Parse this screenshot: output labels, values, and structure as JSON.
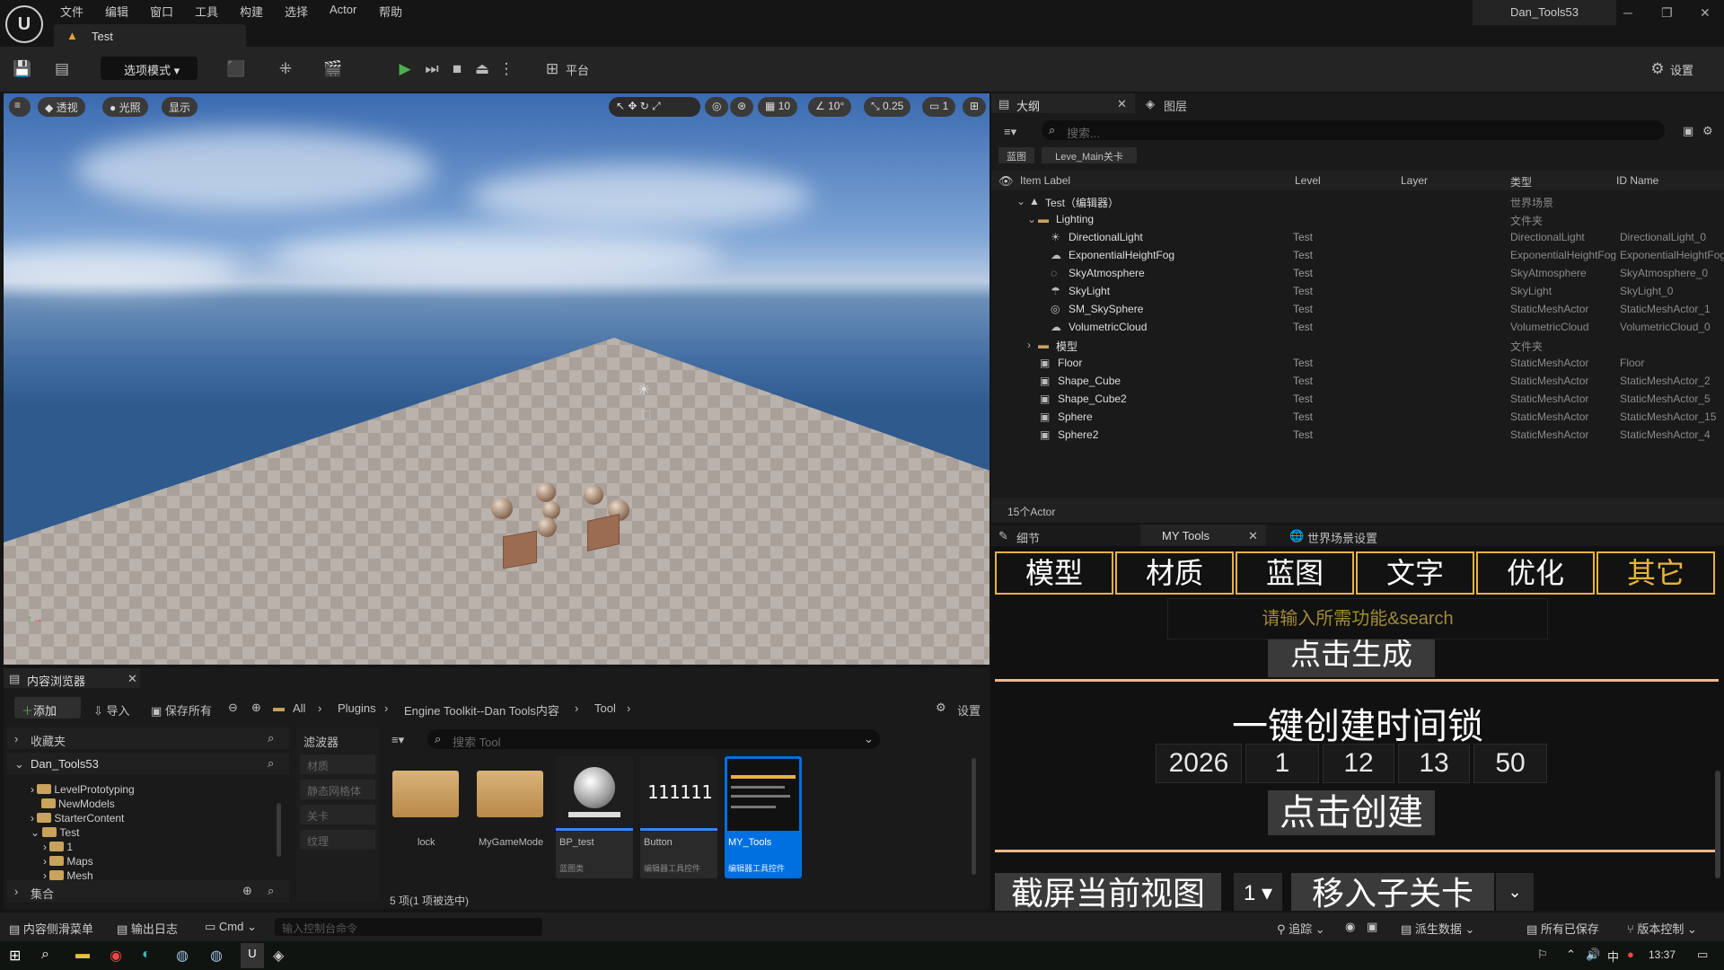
{
  "app": {
    "project_name": "Dan_Tools53",
    "doc_tab": "Test",
    "logo_text": "U"
  },
  "menu": [
    "文件",
    "编辑",
    "窗口",
    "工具",
    "构建",
    "选择",
    "Actor",
    "帮助"
  ],
  "toolbar": {
    "mode_label": "选项模式",
    "platform_label": "平台",
    "settings_label": "设置"
  },
  "viewport": {
    "perspective": "透视",
    "lighting": "光照",
    "show": "显示",
    "grid_size": "10",
    "rotation_snap": "10°",
    "scale_snap": "0.25",
    "camera_speed": "1"
  },
  "outliner": {
    "tab_title": "大纲",
    "layers_tab": "图层",
    "search_placeholder": "搜索...",
    "filter_chips": [
      "蓝图",
      "Leve_Main关卡"
    ],
    "columns": [
      "Item Label",
      "Level",
      "Layer",
      "类型",
      "ID Name"
    ],
    "rows": [
      {
        "label": "Test（编辑器）",
        "level": "",
        "type": "世界场景",
        "id": ""
      },
      {
        "label": "Lighting",
        "level": "",
        "type": "文件夹",
        "id": ""
      },
      {
        "label": "DirectionalLight",
        "level": "Test",
        "type": "DirectionalLight",
        "id": "DirectionalLight_0"
      },
      {
        "label": "ExponentialHeightFog",
        "level": "Test",
        "type": "ExponentialHeightFog",
        "id": "ExponentialHeightFog"
      },
      {
        "label": "SkyAtmosphere",
        "level": "Test",
        "type": "SkyAtmosphere",
        "id": "SkyAtmosphere_0"
      },
      {
        "label": "SkyLight",
        "level": "Test",
        "type": "SkyLight",
        "id": "SkyLight_0"
      },
      {
        "label": "SM_SkySphere",
        "level": "Test",
        "type": "StaticMeshActor",
        "id": "StaticMeshActor_1"
      },
      {
        "label": "VolumetricCloud",
        "level": "Test",
        "type": "VolumetricCloud",
        "id": "VolumetricCloud_0"
      },
      {
        "label": "模型",
        "level": "",
        "type": "文件夹",
        "id": ""
      },
      {
        "label": "Floor",
        "level": "Test",
        "type": "StaticMeshActor",
        "id": "Floor"
      },
      {
        "label": "Shape_Cube",
        "level": "Test",
        "type": "StaticMeshActor",
        "id": "StaticMeshActor_2"
      },
      {
        "label": "Shape_Cube2",
        "level": "Test",
        "type": "StaticMeshActor",
        "id": "StaticMeshActor_5"
      },
      {
        "label": "Sphere",
        "level": "Test",
        "type": "StaticMeshActor",
        "id": "StaticMeshActor_15"
      },
      {
        "label": "Sphere2",
        "level": "Test",
        "type": "StaticMeshActor",
        "id": "StaticMeshActor_4"
      }
    ],
    "actor_count": "15个Actor"
  },
  "details": {
    "details_tab": "细节",
    "tools_tab": "MY Tools",
    "world_tab": "世界场景设置",
    "categories": [
      "模型",
      "材质",
      "蓝图",
      "文字",
      "优化",
      "其它"
    ],
    "search_placeholder": "请输入所需功能&search",
    "generate_label": "点击生成",
    "timelock_title": "一键创建时间锁",
    "time_values": [
      "2026",
      "1",
      "12",
      "13",
      "50"
    ],
    "create_label": "点击创建",
    "screenshot_label": "截屏当前视图",
    "screenshot_count": "1",
    "move_sublevel_label": "移入子关卡"
  },
  "content_browser": {
    "tab_title": "内容浏览器",
    "add": "添加",
    "import": "导入",
    "save_all": "保存所有",
    "path": [
      "All",
      "Plugins",
      "Engine Toolkit--Dan Tools内容",
      "Tool"
    ],
    "settings": "设置",
    "favorites": "收藏夹",
    "project_root": "Dan_Tools53",
    "tree": [
      "LevelPrototyping",
      "NewModels",
      "StarterContent",
      "Test",
      "1",
      "Maps",
      "Mesh"
    ],
    "collections": "集合",
    "filters_title": "滤波器",
    "filters": [
      "材质",
      "静态网格体",
      "关卡",
      "纹理"
    ],
    "search_placeholder": "搜索 Tool",
    "assets": [
      {
        "name": "lock",
        "sub": ""
      },
      {
        "name": "MyGameMode",
        "sub": ""
      },
      {
        "name": "BP_test",
        "sub": "蓝图类"
      },
      {
        "name": "Button",
        "sub": "编辑器工具控件"
      },
      {
        "name": "MY_Tools",
        "sub": "编辑器工具控件"
      }
    ],
    "button_thumb_text": "111111",
    "status": "5 项(1 项被选中)"
  },
  "statusbar": {
    "drawer": "内容侧滑菜单",
    "output_log": "输出日志",
    "cmd": "Cmd",
    "console_placeholder": "输入控制台命令",
    "trace": "追踪",
    "derived_data": "派生数据",
    "all_saved": "所有已保存",
    "source_control": "版本控制"
  },
  "taskbar": {
    "time": "13:37"
  },
  "colors": {
    "accent_orange": "#e8b33a",
    "selection_blue": "#0070e0",
    "play_green": "#4caf50"
  }
}
